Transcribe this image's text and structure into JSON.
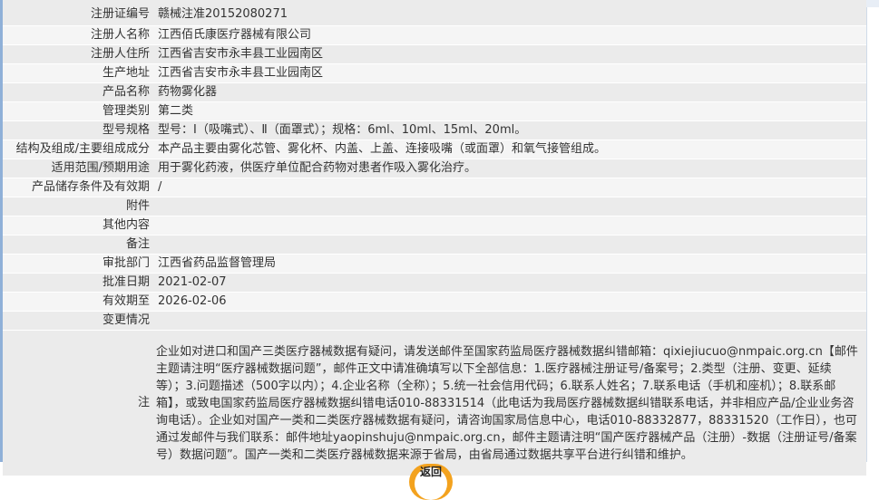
{
  "rows": [
    {
      "label": "注册证编号",
      "value": "赣械注准20152080271"
    },
    {
      "label": "注册人名称",
      "value": "江西佰氏康医疗器械有限公司"
    },
    {
      "label": "注册人住所",
      "value": "江西省吉安市永丰县工业园南区"
    },
    {
      "label": "生产地址",
      "value": "江西省吉安市永丰县工业园南区"
    },
    {
      "label": "产品名称",
      "value": "药物雾化器"
    },
    {
      "label": "管理类别",
      "value": "第二类"
    },
    {
      "label": "型号规格",
      "value": "型号：Ⅰ（吸嘴式）、Ⅱ（面罩式）；规格：6ml、10ml、15ml、20ml。"
    },
    {
      "label": "结构及组成/主要组成成分",
      "value": "本产品主要由雾化芯管、雾化杯、内盖、上盖、连接吸嘴（或面罩）和氧气接管组成。"
    },
    {
      "label": "适用范围/预期用途",
      "value": "用于雾化药液，供医疗单位配合药物对患者作吸入雾化治疗。"
    },
    {
      "label": "产品储存条件及有效期",
      "value": "/"
    },
    {
      "label": "附件",
      "value": ""
    },
    {
      "label": "其他内容",
      "value": ""
    },
    {
      "label": "备注",
      "value": ""
    },
    {
      "label": "审批部门",
      "value": "江西省药品监督管理局"
    },
    {
      "label": "批准日期",
      "value": "2021-02-07"
    },
    {
      "label": "有效期至",
      "value": "2026-02-06"
    },
    {
      "label": "变更情况",
      "value": ""
    }
  ],
  "notes": {
    "label": "注",
    "text": "企业如对进口和国产三类医疗器械数据有疑问，请发送邮件至国家药监局医疗器械数据纠错邮箱：qixiejiucuo@nmpaic.org.cn【邮件主题请注明“医疗器械数据问题”，邮件正文中请准确填写以下全部信息：1.医疗器械注册证号/备案号；2.类型（注册、变更、延续等）；3.问题描述（500字以内）；4.企业名称（全称）；5.统一社会信用代码；6.联系人姓名；7.联系电话（手机和座机）；8.联系邮箱】，或致电国家药监局医疗器械数据纠错电话010-88331514（此电话为我局医疗器械数据纠错联系电话，并非相应产品/企业业务咨询电话）。企业如对国产一类和二类医疗器械数据有疑问，请咨询国家局信息中心，电话010-88332877，88331520（工作日），也可通过发邮件与我们联系：邮件地址yaopinshuju@nmpaic.org.cn，邮件主题请注明“国产医疗器械产品（注册）-数据（注册证号/备案号）数据问题”。国产一类和二类医疗器械数据来源于省局，由省局通过数据共享平台进行纠错和维护。"
  },
  "back_button": {
    "label": "返回"
  },
  "colors": {
    "row_odd": "#ebebeb",
    "row_even": "#f5f5f5",
    "accent": "#f3a21e",
    "text": "#333333"
  }
}
